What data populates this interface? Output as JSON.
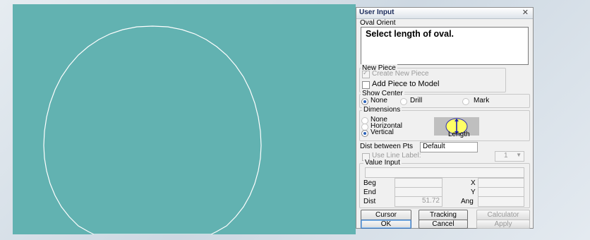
{
  "dialog": {
    "title": "User Input",
    "close_icon": "close-icon",
    "oval_orient_label": "Oval Orient",
    "prompt": "Select length of oval.",
    "new_piece": {
      "label": "New Piece",
      "create_new_piece": "Create New Piece",
      "add_piece_to_model": "Add Piece to Model"
    },
    "show_center": {
      "label": "Show Center",
      "options": [
        "None",
        "Drill",
        "Mark"
      ],
      "selected": "None"
    },
    "dimensions": {
      "label": "Dimensions",
      "options": [
        "None",
        "Horizontal",
        "Vertical"
      ],
      "selected": "Vertical",
      "preview_caption": "Length"
    },
    "dist_between_pts": {
      "label": "Dist between Pts",
      "value": "Default"
    },
    "use_line_label": {
      "label": "Use Line Label:",
      "value": "1"
    },
    "value_input": {
      "label": "Value Input",
      "beg_label": "Beg",
      "end_label": "End",
      "dist_label": "Dist",
      "dist_value": "51.72",
      "x_label": "X",
      "y_label": "Y",
      "ang_label": "Ang"
    },
    "buttons": {
      "cursor": "Cursor",
      "tracking": "Tracking",
      "calculator": "Calculator",
      "ok": "OK",
      "cancel": "Cancel",
      "apply": "Apply"
    }
  },
  "colors": {
    "canvas": "#62b2b1",
    "oval_stroke": "#ffffff",
    "preview_fill": "#ffff66"
  }
}
